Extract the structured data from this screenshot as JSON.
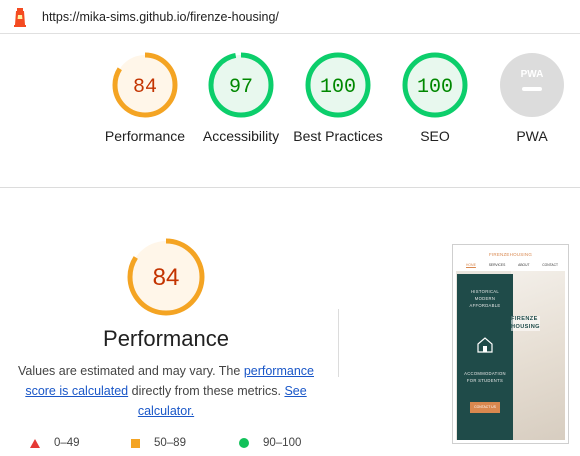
{
  "url_bar": {
    "url": "https://mika-sims.github.io/firenze-housing/",
    "logo_icon": "lighthouse-icon"
  },
  "colors": {
    "average": "#f4a423",
    "average_bg": "#fff6e9",
    "average_text": "#c33300",
    "pass": "#0cce6b",
    "pass_bg": "#e8f8ee",
    "pass_text": "#008800",
    "fail": "#e53935",
    "pwa_bg": "#dcdcdc"
  },
  "gauges": [
    {
      "label": "Performance",
      "score": 84
    },
    {
      "label": "Accessibility",
      "score": 97
    },
    {
      "label": "Best Practices",
      "score": 100
    },
    {
      "label": "SEO",
      "score": 100
    },
    {
      "label": "PWA",
      "badge_text": "PWA"
    }
  ],
  "performance": {
    "score": 84,
    "title": "Performance",
    "desc_part1": "Values are estimated and may vary. The ",
    "desc_link1": "performance score is calculated",
    "desc_part2": " directly from these metrics. ",
    "desc_link2": "See calculator."
  },
  "legend": [
    {
      "range": "0–49",
      "icon": "fail-triangle-icon"
    },
    {
      "range": "50–89",
      "icon": "average-square-icon"
    },
    {
      "range": "90–100",
      "icon": "pass-circle-icon"
    }
  ],
  "thumbnail": {
    "brand": "FIRENZEHOUSING",
    "nav": [
      "HOME",
      "SERVICES",
      "ABOUT",
      "CONTACT"
    ],
    "heading_lines": [
      "HISTORICAL",
      "MODERN",
      "AFFORDABLE"
    ],
    "firenze_lines": [
      "FIRENZE",
      "HOUSING"
    ],
    "accommodation_lines": [
      "ACCOMMODATION",
      "FOR STUDENTS"
    ],
    "cta": "CONTACT US"
  }
}
